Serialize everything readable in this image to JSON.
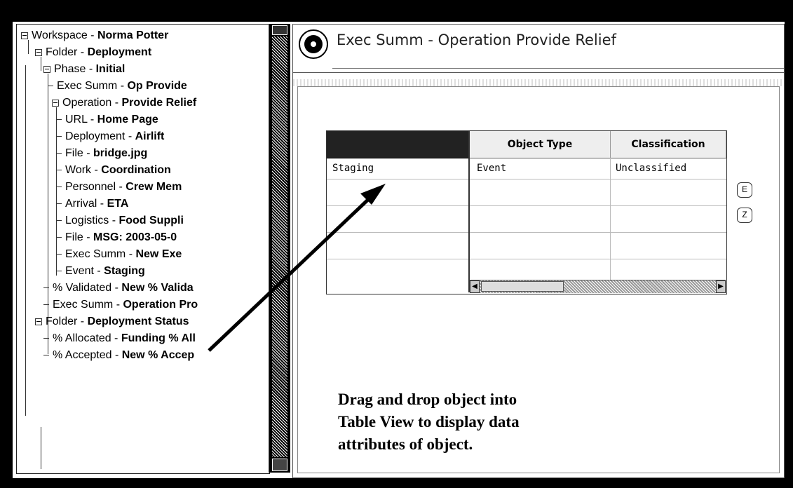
{
  "tree": {
    "rows": [
      {
        "type": "Workspace",
        "sep": " - ",
        "name": "Norma Potter"
      },
      {
        "type": "Folder",
        "sep": " - ",
        "name": "Deployment"
      },
      {
        "type": "Phase",
        "sep": " - ",
        "name": "Initial"
      },
      {
        "type": "Exec Summ",
        "sep": " - ",
        "name": "Op Provide"
      },
      {
        "type": "Operation",
        "sep": " - ",
        "name": "Provide Relief"
      },
      {
        "type": "URL",
        "sep": " - ",
        "name": "Home Page"
      },
      {
        "type": "Deployment",
        "sep": " - ",
        "name": "Airlift"
      },
      {
        "type": "File",
        "sep": " - ",
        "name": "bridge.jpg"
      },
      {
        "type": "Work",
        "sep": " - ",
        "name": "Coordination"
      },
      {
        "type": "Personnel",
        "sep": " - ",
        "name": "Crew Mem"
      },
      {
        "type": "Arrival",
        "sep": " - ",
        "name": "ETA"
      },
      {
        "type": "Logistics",
        "sep": " - ",
        "name": "Food Suppli"
      },
      {
        "type": "File",
        "sep": " - ",
        "name": "MSG: 2003-05-0"
      },
      {
        "type": "Exec Summ",
        "sep": " - ",
        "name": "New Exe"
      },
      {
        "type": "Event",
        "sep": " - ",
        "name": "Staging"
      },
      {
        "type": "% Validated",
        "sep": " - ",
        "name": "New % Valida"
      },
      {
        "type": "Exec Summ",
        "sep": " - ",
        "name": "Operation Pro"
      },
      {
        "type": "Folder",
        "sep": " - ",
        "name": "Deployment Status"
      },
      {
        "type": "% Allocated",
        "sep": " - ",
        "name": "Funding % All"
      },
      {
        "type": "% Accepted",
        "sep": " - ",
        "name": "New % Accep"
      }
    ]
  },
  "header": {
    "title": "Exec Summ - Operation Provide Relief"
  },
  "table_view": {
    "left_cell": "Staging",
    "columns": [
      "Object Type",
      "Classification"
    ],
    "rows": [
      [
        "Event",
        "Unclassified"
      ]
    ]
  },
  "instruction": {
    "line1": "Drag and drop object into",
    "line2": "Table View to display data",
    "line3": "attributes of object."
  },
  "side_buttons": [
    "E",
    "Z"
  ]
}
